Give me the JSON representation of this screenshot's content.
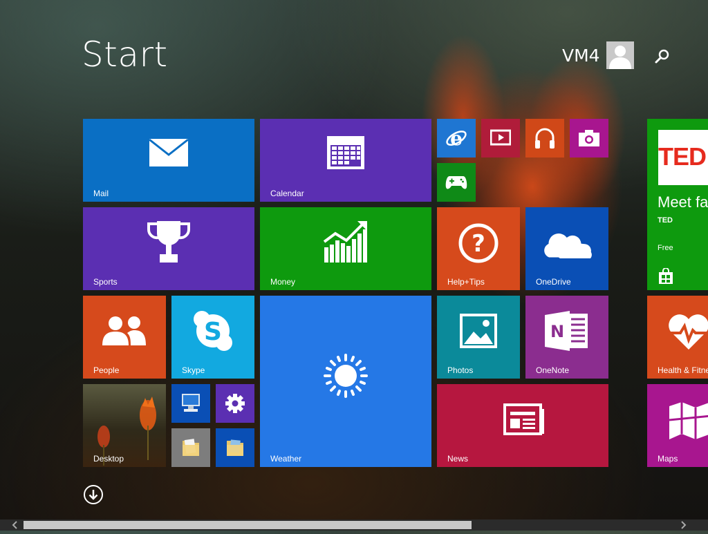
{
  "header": {
    "title": "Start",
    "user_name": "VM4"
  },
  "tiles": {
    "mail": {
      "label": "Mail",
      "color": "#0a6fc4",
      "icon": "mail-icon"
    },
    "calendar": {
      "label": "Calendar",
      "color": "#5b2fb2",
      "icon": "calendar-icon"
    },
    "ie": {
      "color": "#1f76d2",
      "icon": "internet-explorer-icon"
    },
    "video": {
      "color": "#b01c3a",
      "icon": "video-icon"
    },
    "music": {
      "color": "#d04818",
      "icon": "headphones-icon"
    },
    "camera": {
      "color": "#a8168f",
      "icon": "camera-icon"
    },
    "games": {
      "color": "#0f8a17",
      "icon": "game-controller-icon"
    },
    "sports": {
      "label": "Sports",
      "color": "#5b2fb2",
      "icon": "trophy-icon"
    },
    "money": {
      "label": "Money",
      "color": "#0e9a0e",
      "icon": "chart-icon"
    },
    "help": {
      "label": "Help+Tips",
      "color": "#d64a1c",
      "icon": "question-icon"
    },
    "onedrive": {
      "label": "OneDrive",
      "color": "#0a4fb5",
      "icon": "cloud-icon"
    },
    "ted": {
      "logo": "TED",
      "headline": "Meet fas",
      "subtitle": "TED",
      "price": "Free",
      "color": "#0e9a0e",
      "icon": "store-icon"
    },
    "people": {
      "label": "People",
      "color": "#d64a1c",
      "icon": "people-icon"
    },
    "skype": {
      "label": "Skype",
      "color": "#12a9e0",
      "icon": "skype-icon"
    },
    "weather": {
      "label": "Weather",
      "color": "#2578e6",
      "icon": "sun-icon"
    },
    "photos": {
      "label": "Photos",
      "color": "#0b8a9a",
      "icon": "photo-icon"
    },
    "onenote": {
      "label": "OneNote",
      "color": "#8b2d8f",
      "icon": "onenote-icon"
    },
    "health": {
      "label": "Health & Fitne",
      "color": "#d64a1c",
      "icon": "heart-icon"
    },
    "desktop": {
      "label": "Desktop",
      "icon": "desktop-icon"
    },
    "computer": {
      "color": "#0a4fb5",
      "icon": "computer-icon"
    },
    "settings": {
      "color": "#5b2fb2",
      "icon": "gear-icon"
    },
    "file_explorer": {
      "color": "#7d7d7d",
      "icon": "folder-icon"
    },
    "documents": {
      "color": "#0a4fb5",
      "icon": "folder-documents-icon"
    },
    "news": {
      "label": "News",
      "color": "#b6173f",
      "icon": "newspaper-icon"
    },
    "maps": {
      "label": "Maps",
      "color": "#a8168f",
      "icon": "map-icon"
    }
  },
  "footer": {
    "all_apps_icon": "down-arrow-icon",
    "scroll_position": 0.63
  }
}
